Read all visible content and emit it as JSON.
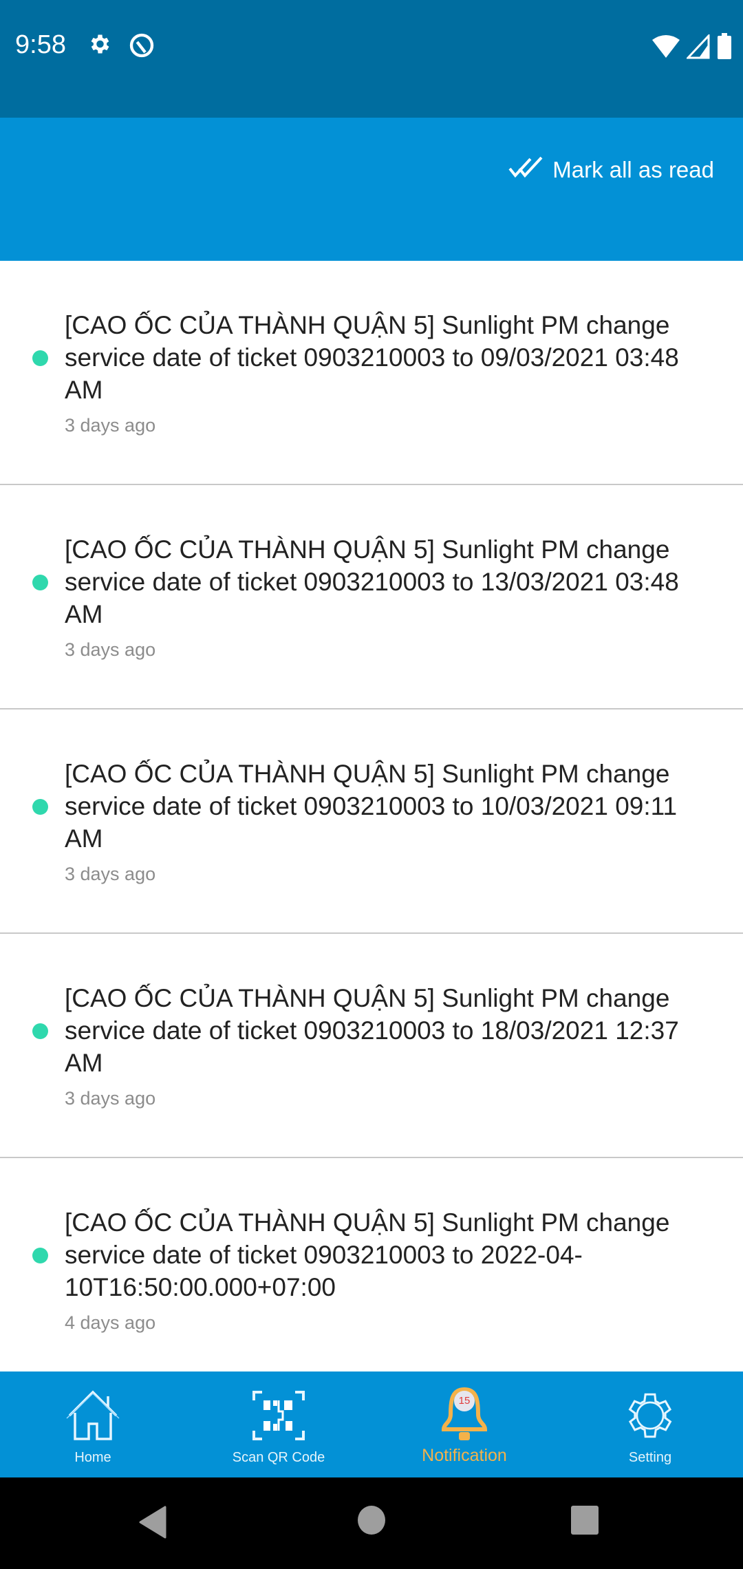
{
  "status_bar": {
    "time": "9:58",
    "left_icons": [
      "settings-gear-icon",
      "q-circle-icon"
    ],
    "right_icons": [
      "wifi-icon",
      "cellular-signal-icon",
      "battery-icon"
    ]
  },
  "header": {
    "mark_all_label": "Mark all as read",
    "mark_all_icon": "double-check-icon"
  },
  "notifications": [
    {
      "title": "[CAO ỐC CỦA THÀNH QUẬN 5] Sunlight PM change service date of ticket 0903210003 to 09/03/2021 03:48 AM",
      "time": "3 days ago",
      "unread": true
    },
    {
      "title": "[CAO ỐC CỦA THÀNH QUẬN 5] Sunlight PM change service date of ticket 0903210003 to 13/03/2021 03:48 AM",
      "time": "3 days ago",
      "unread": true
    },
    {
      "title": "[CAO ỐC CỦA THÀNH QUẬN 5] Sunlight PM change service date of ticket 0903210003 to 10/03/2021 09:11 AM",
      "time": "3 days ago",
      "unread": true
    },
    {
      "title": "[CAO ỐC CỦA THÀNH QUẬN 5] Sunlight PM change service date of ticket 0903210003 to 18/03/2021 12:37 AM",
      "time": "3 days ago",
      "unread": true
    },
    {
      "title": "[CAO ỐC CỦA THÀNH QUẬN 5] Sunlight PM change service date of ticket 0903210003 to 2022-04-10T16:50:00.000+07:00",
      "time": "4 days ago",
      "unread": true
    }
  ],
  "bottom_nav": {
    "tabs": [
      {
        "label": "Home",
        "icon": "home-icon",
        "active": false
      },
      {
        "label": "Scan QR Code",
        "icon": "qr-code-icon",
        "active": false
      },
      {
        "label": "Notification",
        "icon": "bell-icon",
        "active": true,
        "badge": "15"
      },
      {
        "label": "Setting",
        "icon": "gear-icon",
        "active": false
      }
    ]
  },
  "colors": {
    "status_bar": "#006d9f",
    "primary": "#0391d6",
    "unread_dot": "#2fd8ad",
    "active_tab": "#f4b24a",
    "badge_text": "#e03b3b"
  }
}
